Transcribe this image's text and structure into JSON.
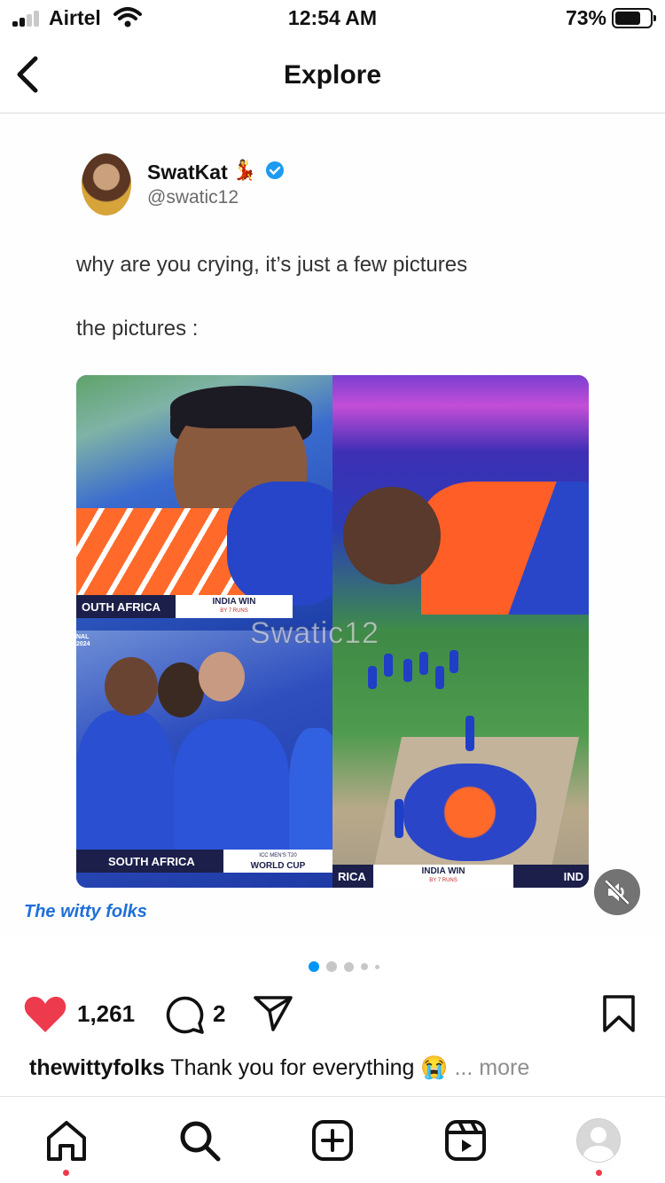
{
  "status_bar": {
    "carrier": "Airtel",
    "time": "12:54 AM",
    "battery_percent": "73%",
    "battery_level": 0.73,
    "signal_bars": 2
  },
  "nav": {
    "title": "Explore",
    "back_icon": "chevron-left-icon"
  },
  "post": {
    "tweet": {
      "name": "SwatKat",
      "name_deco": "💃",
      "handle": "@swatic12",
      "line1": "why are you crying, it’s just a few pictures",
      "line2": "the pictures :"
    },
    "collage": {
      "banner_south_africa_1": "OUTH AFRICA",
      "banner_india_win_1": "INDIA WIN",
      "banner_india_win_1_sub": "BY 7 RUNS",
      "side_label": "NAL 2024",
      "banner_south_africa_2": "SOUTH AFRICA",
      "world_cup_logo": "WORLD CUP",
      "world_cup_sub": "ICC MEN'S T20",
      "banner_rica": "RICA",
      "banner_india_win_2": "INDIA WIN",
      "banner_india_win_2_sub": "BY 7 RUNS",
      "banner_ind": "IND",
      "watermark": "Swatic12"
    },
    "brand_watermark": "The witty folks",
    "carousel": {
      "count": 5,
      "active": 0
    },
    "likes": "1,261",
    "comments": "2",
    "caption_user": "thewittyfolks",
    "caption_text": "Thank you for everything 😭",
    "caption_more": "... more"
  },
  "tabbar": {
    "items": [
      "home-icon",
      "search-icon",
      "create-post-icon",
      "reels-icon",
      "profile-avatar"
    ]
  },
  "colors": {
    "like": "#ed3a4d",
    "verified": "#1d9bf0",
    "active_dot": "#0095f6",
    "notification_dot": "#ed3a4d"
  }
}
